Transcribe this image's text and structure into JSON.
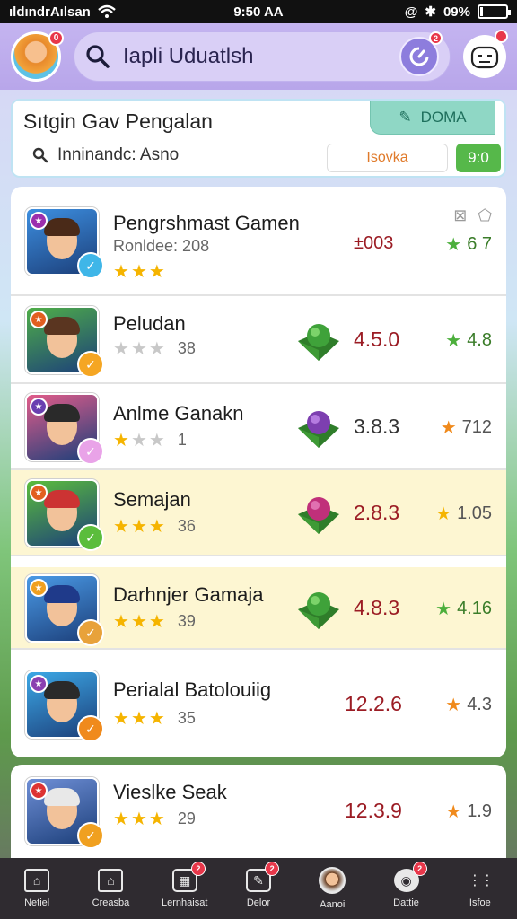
{
  "status_bar": {
    "carrier": "ıldındrAılsan",
    "time": "9:50 AA",
    "battery": "09%",
    "battery_level": 0.09
  },
  "header": {
    "search_label": "Iapli Uduatlsh",
    "avatar_badge": "0",
    "refresh_badge": "2",
    "bot_badge": ""
  },
  "filter": {
    "title": "Sıtgin Gav Pengalan",
    "tab_label": "DOMA",
    "search_text": "Inninandc: Asno",
    "select_value": "Isovka",
    "go_label": "9:0"
  },
  "games": [
    {
      "title": "Pengrshmast Gamen",
      "sub": "Ronldee: 208",
      "stars": 3,
      "stars_text": "",
      "score": "±003",
      "score_style": "red",
      "rating": "6 7",
      "rating_star_color": "#4caf3c",
      "gem": "",
      "highlight": false,
      "thumb_bg": "#3d8fe0",
      "badge_color": "#9b2fae",
      "coin_color": "#3fb6e8",
      "hair": "#4a2a18",
      "top_icons": true
    },
    {
      "title": "Peludan",
      "sub": "",
      "stars": 0,
      "stars_text": "38",
      "score": "4.5.0",
      "score_style": "red",
      "rating": "4.8",
      "rating_star_color": "#4caf3c",
      "gem": "green",
      "highlight": false,
      "thumb_bg": "#4fae48",
      "badge_color": "#e25f20",
      "coin_color": "#f5a623",
      "hair": "#5a3520",
      "top_icons": false
    },
    {
      "title": "Anlme Ganakn",
      "sub": "",
      "stars": 1,
      "stars_text": "1",
      "score": "3.8.3",
      "score_style": "",
      "rating": "712",
      "rating_star_color": "#f08a1c",
      "gem": "purple",
      "highlight": false,
      "thumb_bg": "#e25c8a",
      "badge_color": "#6a3fb0",
      "coin_color": "#e9a3e8",
      "hair": "#2a2a2a",
      "top_icons": false
    },
    {
      "title": "Semajan",
      "sub": "",
      "stars": 3,
      "stars_text": "36",
      "score": "2.8.3",
      "score_style": "red",
      "rating": "1.05",
      "rating_star_color": "#f5b400",
      "gem": "pink",
      "highlight": true,
      "thumb_bg": "#5bbd3c",
      "badge_color": "#e25f20",
      "coin_color": "#5bbd3c",
      "hair": "#c33",
      "top_icons": false
    },
    {
      "title": "Darhnjer Gamaja",
      "sub": "",
      "stars": 3,
      "stars_text": "39",
      "score": "4.8.3",
      "score_style": "red",
      "rating": "4.16",
      "rating_star_color": "#4caf3c",
      "gem": "green",
      "highlight": true,
      "thumb_bg": "#4a9ae6",
      "badge_color": "#f0a020",
      "coin_color": "#e8a23a",
      "hair": "#1f3a8a",
      "top_icons": false
    },
    {
      "title": "Perialal Batolouiig",
      "sub": "",
      "stars": 3,
      "stars_text": "35",
      "score": "12.2.6",
      "score_style": "red",
      "rating": "4.3",
      "rating_star_color": "#f08a1c",
      "gem": "",
      "highlight": false,
      "thumb_bg": "#3ca8e6",
      "badge_color": "#8a3fb0",
      "coin_color": "#f08a1c",
      "hair": "#2a2a2a",
      "top_icons": false
    },
    {
      "title": "Vieslke Seak",
      "sub": "",
      "stars": 3,
      "stars_text": "29",
      "score": "12.3.9",
      "score_style": "red",
      "rating": "1.9",
      "rating_star_color": "#f08a1c",
      "gem": "",
      "highlight": false,
      "thumb_bg": "#6f8fd6",
      "badge_color": "#d33",
      "coin_color": "#f0a020",
      "hair": "#e8e8e8",
      "top_icons": false
    }
  ],
  "bottom_nav": [
    {
      "label": "Netiel",
      "icon": "home-icon",
      "badge": ""
    },
    {
      "label": "Creasba",
      "icon": "house-icon",
      "badge": ""
    },
    {
      "label": "Lernhaisat",
      "icon": "chart-icon",
      "badge": "2"
    },
    {
      "label": "Delor",
      "icon": "edit-icon",
      "badge": "2"
    },
    {
      "label": "Aanoi",
      "icon": "avatar-icon",
      "badge": ""
    },
    {
      "label": "Dattie",
      "icon": "controller-icon",
      "badge": "2"
    },
    {
      "label": "Isfoe",
      "icon": "menu-icon",
      "badge": ""
    }
  ]
}
